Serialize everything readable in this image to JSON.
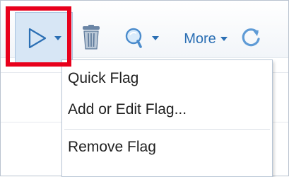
{
  "toolbar": {
    "more_label": "More",
    "icons": {
      "flag": "flag-icon",
      "delete": "trash-icon",
      "find": "search-icon",
      "refresh": "refresh-icon"
    }
  },
  "flag_menu": {
    "items": [
      {
        "label": "Quick Flag"
      },
      {
        "label": "Add or Edit Flag..."
      },
      {
        "label": "Remove Flag"
      }
    ]
  },
  "colors": {
    "highlight": "#e8001c",
    "accent": "#2b6fb4"
  }
}
